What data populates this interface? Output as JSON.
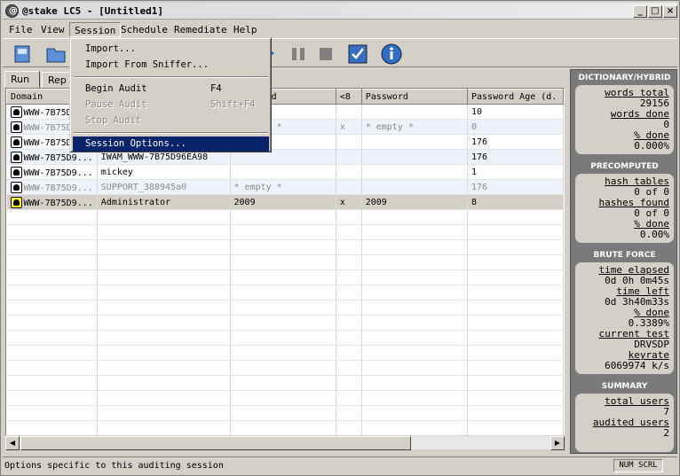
{
  "window": {
    "title": "@stake LC5 - [Untitled1]"
  },
  "menubar": [
    "File",
    "View",
    "Session",
    "Schedule",
    "Remediate",
    "Help"
  ],
  "session_menu": [
    {
      "label": "Import...",
      "shortcut": "",
      "disabled": false
    },
    {
      "label": "Import From Sniffer...",
      "shortcut": "",
      "disabled": false
    },
    {
      "label": "Begin Audit",
      "shortcut": "F4",
      "disabled": false
    },
    {
      "label": "Pause Audit",
      "shortcut": "",
      "disabled": true
    },
    {
      "label": "Stop Audit",
      "shortcut": "Shift+F4",
      "disabled": true
    },
    {
      "label": "Session Options...",
      "shortcut": "",
      "disabled": false,
      "highlighted": true
    }
  ],
  "tabs": [
    "Run",
    "Rep"
  ],
  "table": {
    "headers": [
      "Domain",
      "",
      "Password",
      "<8",
      "Password",
      "Password Age (d."
    ],
    "rows": [
      [
        "WWW-7B75D",
        "",
        "",
        "",
        "",
        "10"
      ],
      [
        "WWW-7B75D",
        "",
        "* empty *",
        "x",
        "* empty *",
        "0"
      ],
      [
        "WWW-7B75D",
        "",
        "",
        "",
        "",
        "176"
      ],
      [
        "WWW-7B75D9...",
        "IWAM_WWW-7B75D96EA98",
        "",
        "",
        "",
        "176"
      ],
      [
        "WWW-7B75D9...",
        "mickey",
        "",
        "",
        "",
        "1"
      ],
      [
        "WWW-7B75D9...",
        "SUPPORT_388945a0",
        "* empty *",
        "",
        "",
        "176"
      ],
      [
        "WWW-7B75D9...",
        "Administrator",
        "2009",
        "x",
        "2009",
        "8"
      ]
    ]
  },
  "status": {
    "text": "Options specific to this auditing session",
    "caps": "NUM SCRL"
  },
  "side": {
    "dictionary": {
      "title": "DICTIONARY/HYBRID",
      "lines": [
        "words total",
        "29156",
        "words done",
        "0",
        "% done",
        "0.000%"
      ]
    },
    "precomputed": {
      "title": "PRECOMPUTED",
      "lines": [
        "hash tables",
        "0 of 0",
        "hashes found",
        "0 of 0",
        "% done",
        "0.00%"
      ]
    },
    "brute": {
      "title": "BRUTE FORCE",
      "lines": [
        "time elapsed",
        "0d 0h 0m45s",
        "time left",
        "0d 3h40m33s",
        "% done",
        "0.3389%",
        "current test",
        "DRVSDP",
        "keyrate",
        "6069974 k/s"
      ]
    },
    "summary": {
      "title": "SUMMARY",
      "lines": [
        "total users",
        "7",
        "audited users",
        "2"
      ]
    }
  }
}
